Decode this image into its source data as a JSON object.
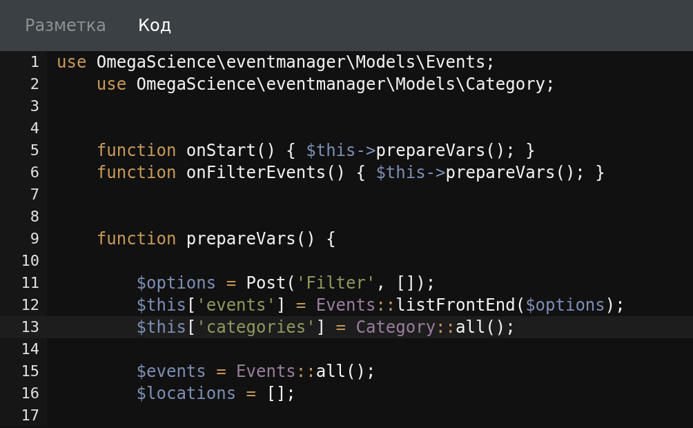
{
  "tabs": [
    {
      "label": "Разметка",
      "selected": false
    },
    {
      "label": "Код",
      "selected": true
    }
  ],
  "editor": {
    "lines": [
      {
        "number": "1",
        "selected": false,
        "tokens": [
          {
            "kind": "keyword",
            "text": "use"
          },
          {
            "kind": "plain",
            "text": " OmegaScience\\eventmanager\\Models\\Events;"
          }
        ]
      },
      {
        "number": "2",
        "selected": false,
        "tokens": [
          {
            "kind": "keyword",
            "text": "    use"
          },
          {
            "kind": "plain",
            "text": " OmegaScience\\eventmanager\\Models\\Category;"
          }
        ]
      },
      {
        "number": "3"
      },
      {
        "number": "4"
      },
      {
        "number": "5",
        "selected": false,
        "tokens": [
          {
            "kind": "keyword",
            "text": "    function"
          },
          {
            "kind": "plain",
            "text": " onStart() { "
          },
          {
            "kind": "variable",
            "text": "$this->"
          },
          {
            "kind": "plain",
            "text": "prepareVars(); }"
          }
        ]
      },
      {
        "number": "6",
        "selected": false,
        "tokens": [
          {
            "kind": "keyword",
            "text": "    function"
          },
          {
            "kind": "plain",
            "text": " onFilterEvents() { "
          },
          {
            "kind": "variable",
            "text": "$this->"
          },
          {
            "kind": "plain",
            "text": "prepareVars(); }"
          }
        ]
      },
      {
        "number": "7"
      },
      {
        "number": "8"
      },
      {
        "number": "9",
        "selected": false,
        "tokens": [
          {
            "kind": "keyword",
            "text": "    function"
          },
          {
            "kind": "plain",
            "text": " prepareVars() {"
          }
        ]
      },
      {
        "number": "10"
      },
      {
        "number": "11",
        "selected": false,
        "tokens": [
          {
            "kind": "variable",
            "text": "        $options"
          },
          {
            "kind": "operator",
            "text": " = "
          },
          {
            "kind": "plain",
            "text": "Post("
          },
          {
            "kind": "string",
            "text": "'Filter'"
          },
          {
            "kind": "plain",
            "text": ", []);"
          }
        ]
      },
      {
        "number": "12",
        "selected": false,
        "tokens": [
          {
            "kind": "variable",
            "text": "        $this"
          },
          {
            "kind": "plain",
            "text": "["
          },
          {
            "kind": "string",
            "text": "'events'"
          },
          {
            "kind": "plain",
            "text": "]"
          },
          {
            "kind": "operator",
            "text": " = "
          },
          {
            "kind": "class",
            "text": "Events"
          },
          {
            "kind": "operator",
            "text": "::"
          },
          {
            "kind": "plain",
            "text": "listFrontEnd("
          },
          {
            "kind": "variable",
            "text": "$options"
          },
          {
            "kind": "plain",
            "text": ");"
          }
        ]
      },
      {
        "number": "13",
        "selected": true,
        "tokens": [
          {
            "kind": "variable",
            "text": "        $this"
          },
          {
            "kind": "plain",
            "text": "["
          },
          {
            "kind": "string",
            "text": "'categories'"
          },
          {
            "kind": "plain",
            "text": "]"
          },
          {
            "kind": "operator",
            "text": " = "
          },
          {
            "kind": "class",
            "text": "Category"
          },
          {
            "kind": "operator",
            "text": "::"
          },
          {
            "kind": "plain",
            "text": "all();"
          }
        ]
      },
      {
        "number": "14"
      },
      {
        "number": "15",
        "selected": false,
        "tokens": [
          {
            "kind": "variable",
            "text": "        $events"
          },
          {
            "kind": "operator",
            "text": " = "
          },
          {
            "kind": "class",
            "text": "Events"
          },
          {
            "kind": "operator",
            "text": "::"
          },
          {
            "kind": "plain",
            "text": "all();"
          }
        ]
      },
      {
        "number": "16",
        "selected": false,
        "tokens": [
          {
            "kind": "variable",
            "text": "        $locations"
          },
          {
            "kind": "operator",
            "text": " = "
          },
          {
            "kind": "plain",
            "text": "[];"
          }
        ]
      },
      {
        "number": "17"
      }
    ]
  }
}
